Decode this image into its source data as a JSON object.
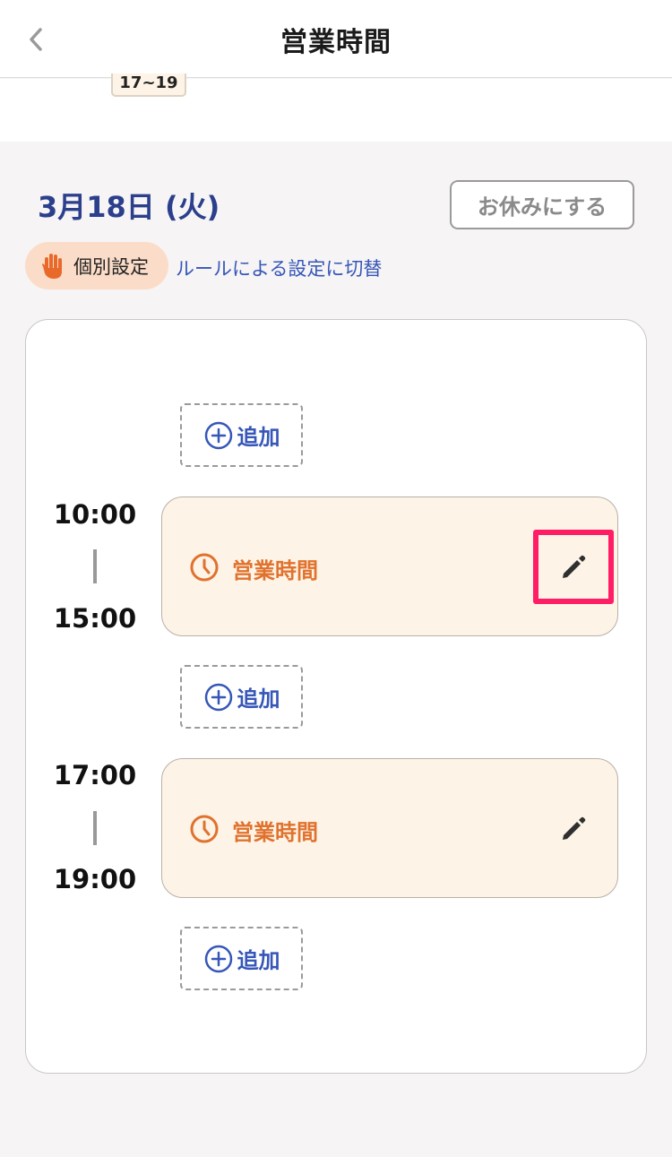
{
  "header": {
    "title": "営業時間",
    "back_icon": "chevron-left-icon"
  },
  "top_strip": {
    "chip_label": "17~19"
  },
  "day": {
    "date_label": "3月18日 (火)",
    "holiday_button": "お休みにする"
  },
  "mode": {
    "badge_icon": "hand-icon",
    "badge_label": "個別設定",
    "switch_link": "ルールによる設定に切替"
  },
  "slots": {
    "add_label": "追加",
    "items": [
      {
        "start": "10:00",
        "end": "15:00",
        "label": "営業時間",
        "edit_highlighted": true
      },
      {
        "start": "17:00",
        "end": "19:00",
        "label": "営業時間",
        "edit_highlighted": false
      }
    ]
  },
  "colors": {
    "accent_blue": "#3656b8",
    "date_blue": "#2b3f8c",
    "slot_orange": "#e0722e",
    "slot_bg": "#fdf3e6",
    "badge_bg": "#fbdcc8",
    "highlight": "#ff1e66"
  }
}
